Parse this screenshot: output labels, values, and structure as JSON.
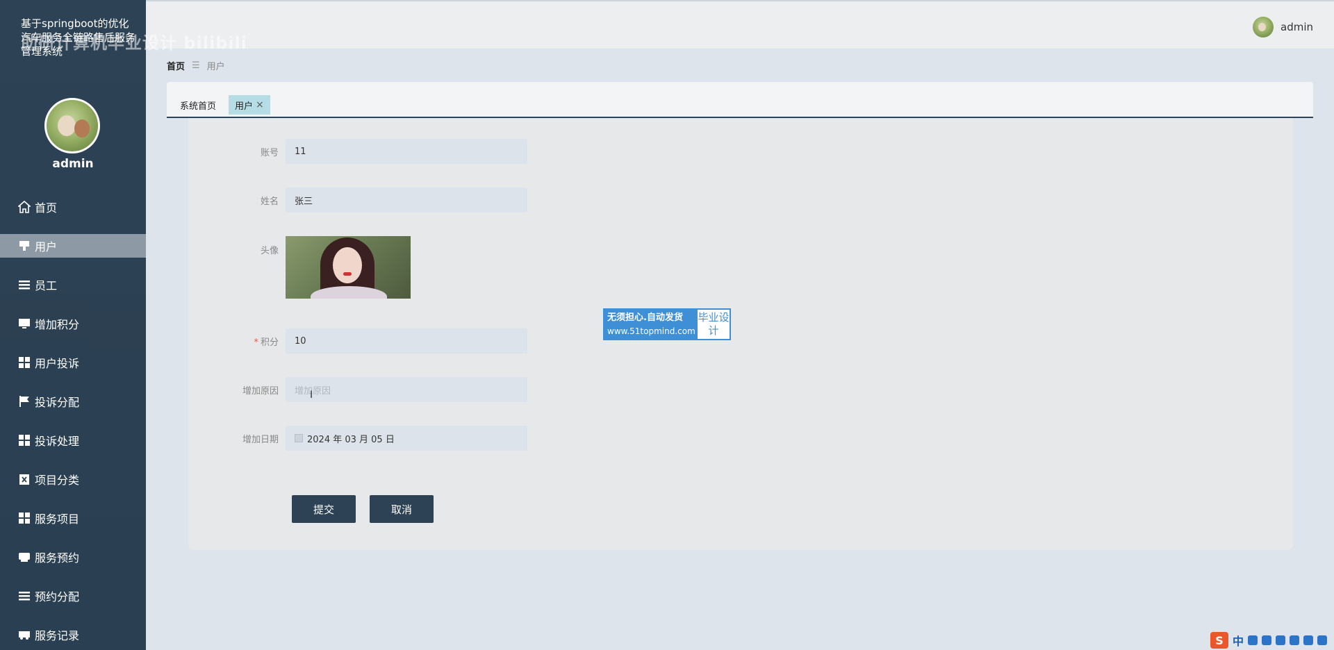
{
  "app": {
    "title": "基于springboot的优化汽车服务全链路售后服务管理系统",
    "watermark": "助研计算机毕业设计 bilibili"
  },
  "sidebar": {
    "username": "admin",
    "items": [
      {
        "label": "首页",
        "icon": "home-icon"
      },
      {
        "label": "用户",
        "icon": "user-icon",
        "active": true
      },
      {
        "label": "员工",
        "icon": "list-icon"
      },
      {
        "label": "增加积分",
        "icon": "monitor-icon"
      },
      {
        "label": "用户投诉",
        "icon": "grid-icon"
      },
      {
        "label": "投诉分配",
        "icon": "flag-icon"
      },
      {
        "label": "投诉处理",
        "icon": "grid-icon"
      },
      {
        "label": "项目分类",
        "icon": "clipboard-icon"
      },
      {
        "label": "服务项目",
        "icon": "grid-icon"
      },
      {
        "label": "服务预约",
        "icon": "inbox-icon"
      },
      {
        "label": "预约分配",
        "icon": "list-icon"
      },
      {
        "label": "服务记录",
        "icon": "car-icon"
      }
    ]
  },
  "header": {
    "username": "admin"
  },
  "breadcrumb": {
    "home": "首页",
    "separator": "☰",
    "current": "用户"
  },
  "tabs": [
    {
      "label": "系统首页"
    },
    {
      "label": "用户",
      "active": true,
      "close": "×"
    }
  ],
  "form": {
    "account": {
      "label": "账号",
      "value": "11"
    },
    "name": {
      "label": "姓名",
      "value": "张三"
    },
    "avatar": {
      "label": "头像"
    },
    "points": {
      "label": "积分",
      "required_mark": "*",
      "value": "10"
    },
    "reason": {
      "label": "增加原因",
      "placeholder": "增加原因"
    },
    "date": {
      "label": "增加日期",
      "value": "2024 年 03 月 05 日"
    },
    "submit_label": "提交",
    "cancel_label": "取消"
  },
  "ad": {
    "line1": "无须担心.自动发货",
    "line2": "www.51topmind.com",
    "badge": "毕业设计"
  },
  "tray": {
    "ime": "S",
    "lang": "中"
  },
  "colors": {
    "sidebar": "#2d4254",
    "active_tab": "#b6dde6",
    "button": "#2d4254",
    "required": "#e05a5a"
  }
}
